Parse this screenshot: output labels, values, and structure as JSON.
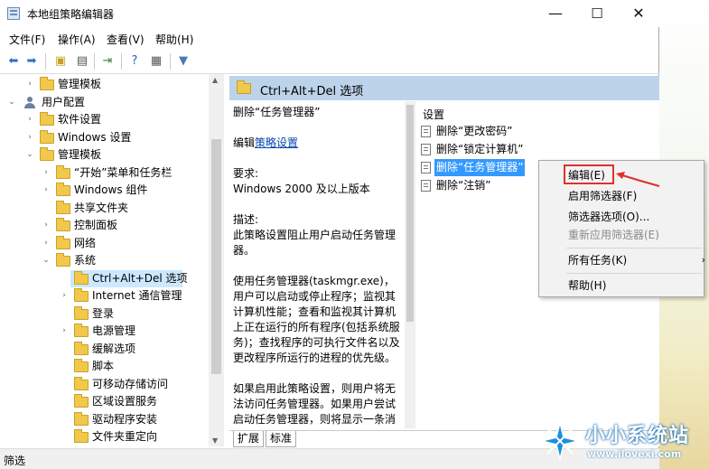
{
  "window": {
    "title": "本地组策略编辑器"
  },
  "window_controls": {
    "minimize": "—",
    "maximize": "☐",
    "close": "✕"
  },
  "menu": [
    "文件(F)",
    "操作(A)",
    "查看(V)",
    "帮助(H)"
  ],
  "tree": [
    {
      "label": "管理模板",
      "expander": "›"
    },
    {
      "label": "用户配置",
      "expander": "⌄"
    },
    {
      "label": "软件设置",
      "expander": "›"
    },
    {
      "label": "Windows 设置",
      "expander": "›"
    },
    {
      "label": "管理模板",
      "expander": "⌄"
    },
    {
      "label": "“开始”菜单和任务栏",
      "expander": "›"
    },
    {
      "label": "Windows 组件",
      "expander": "›"
    },
    {
      "label": "共享文件夹",
      "expander": ""
    },
    {
      "label": "控制面板",
      "expander": "›"
    },
    {
      "label": "网络",
      "expander": "›"
    },
    {
      "label": "系统",
      "expander": "⌄"
    },
    {
      "label": "Ctrl+Alt+Del 选项",
      "expander": ""
    },
    {
      "label": "Internet 通信管理",
      "expander": "›"
    },
    {
      "label": "登录",
      "expander": ""
    },
    {
      "label": "电源管理",
      "expander": "›"
    },
    {
      "label": "缓解选项",
      "expander": ""
    },
    {
      "label": "脚本",
      "expander": ""
    },
    {
      "label": "可移动存储访问",
      "expander": ""
    },
    {
      "label": "区域设置服务",
      "expander": ""
    },
    {
      "label": "驱动程序安装",
      "expander": ""
    },
    {
      "label": "文件夹重定向",
      "expander": ""
    }
  ],
  "right": {
    "header": "Ctrl+Alt+Del 选项",
    "desc_title": "删除“任务管理器”",
    "edit_prefix": "编辑",
    "edit_link": "策略设置",
    "req_label": "要求:",
    "req_value": "Windows 2000 及以上版本",
    "desc_label": "描述:",
    "desc_text": "此策略设置阻止用户启动任务管理器。",
    "para1": "使用任务管理器(taskmgr.exe)，用户可以启动或停止程序；监视其计算机性能；查看和监视其计算机上正在运行的所有程序(包括系统服务)；查找程序的可执行文件名以及更改程序所运行的进程的优先级。",
    "para2": "如果启用此策略设置，则用户将无法访问任务管理器。如果用户尝试启动任务管理器，则将显示一条消息，说明禁用了此操作。",
    "settings_head": "设置",
    "settings": [
      "删除“更改密码”",
      "删除“锁定计算机”",
      "删除“任务管理器”",
      "删除“注销”"
    ]
  },
  "tabs": [
    "扩展",
    "标准"
  ],
  "status": "筛选",
  "context_menu": {
    "items": [
      "编辑(E)",
      "启用筛选器(F)",
      "筛选器选项(O)...",
      "重新应用筛选器(E)",
      "所有任务(K)",
      "帮助(H)"
    ],
    "submenu_arrow": "›"
  },
  "watermark": {
    "line1": "小小系统站",
    "line2": "www.ilovexi.com"
  },
  "colors": {
    "accent": "#3399ff",
    "highlight_red": "#e0302b",
    "header_bg": "#bcd3ea"
  }
}
